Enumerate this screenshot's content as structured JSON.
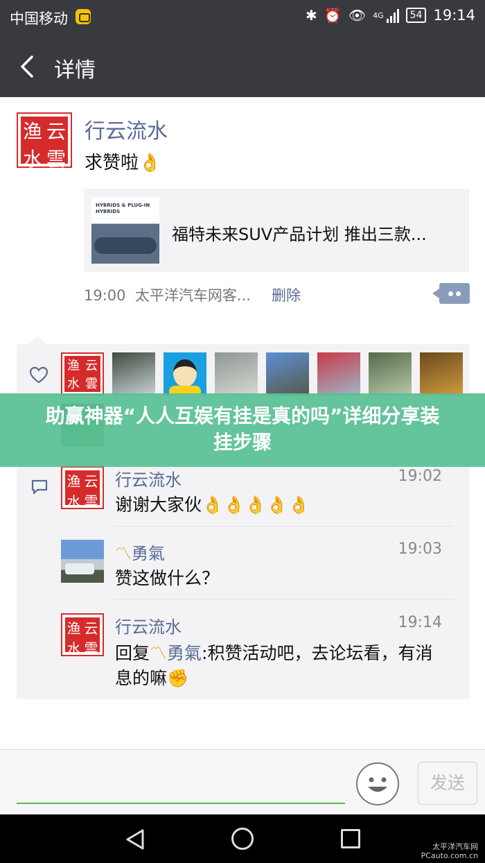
{
  "status_bar": {
    "carrier": "中国移动",
    "network": "4G",
    "battery": "54",
    "time": "19:14"
  },
  "header": {
    "title": "详情"
  },
  "seal_text": [
    "渔",
    "云",
    "水",
    "雲"
  ],
  "post": {
    "author": "行云流水",
    "text": "求赞啦",
    "link": {
      "thumb_text": "HYBRIDS & PLUG-IN HYBRIDS",
      "title": "福特未来SUV产品计划 推出三款..."
    },
    "time": "19:00",
    "source": "太平洋汽车网客...",
    "delete_label": "删除"
  },
  "likers": [
    {
      "kind": "seal"
    },
    {
      "kind": "photo",
      "colors": [
        "#3f4a3c",
        "#c9d2d8"
      ]
    },
    {
      "kind": "cartoon",
      "colors": [
        "#f6d21a",
        "#1aa0e0"
      ]
    },
    {
      "kind": "photo",
      "colors": [
        "#8e9794",
        "#d8d8d2"
      ]
    },
    {
      "kind": "photo",
      "colors": [
        "#5b8fd6",
        "#5a5a4a"
      ]
    },
    {
      "kind": "photo",
      "colors": [
        "#c93a4a",
        "#9fb6c6"
      ]
    },
    {
      "kind": "photo",
      "colors": [
        "#556b4b",
        "#b7c8a6"
      ]
    },
    {
      "kind": "photo",
      "colors": [
        "#6b4a1e",
        "#d19a3c"
      ]
    },
    {
      "kind": "photo",
      "colors": [
        "#2f5a33",
        "#6fae5e"
      ]
    }
  ],
  "comments": [
    {
      "author": "行云流水",
      "time": "19:02",
      "text": "谢谢大家伙",
      "emojis": 5,
      "avatar": "seal"
    },
    {
      "author": "勇氣",
      "time": "19:03",
      "text": "赞这做什么？",
      "avatar": "photo"
    },
    {
      "author": "行云流水",
      "time": "19:14",
      "reply_prefix": "回复",
      "reply_to": "勇氣",
      "text": ":积赞活动吧，去论坛看，有消息的嘛",
      "avatar": "seal"
    }
  ],
  "banner": {
    "text": "助赢神器“人人互娱有挂是真的吗”详细分享装挂步骤"
  },
  "input_bar": {
    "send_label": "发送"
  },
  "watermark": {
    "line1": "太平洋汽车网",
    "line2": "PCauto.com.cn"
  },
  "colors": {
    "bar": "#393a3f",
    "link_blue": "#576b95",
    "seal_red": "#d62b2b",
    "banner_green": "#58c094",
    "input_green": "#5ab84a"
  }
}
